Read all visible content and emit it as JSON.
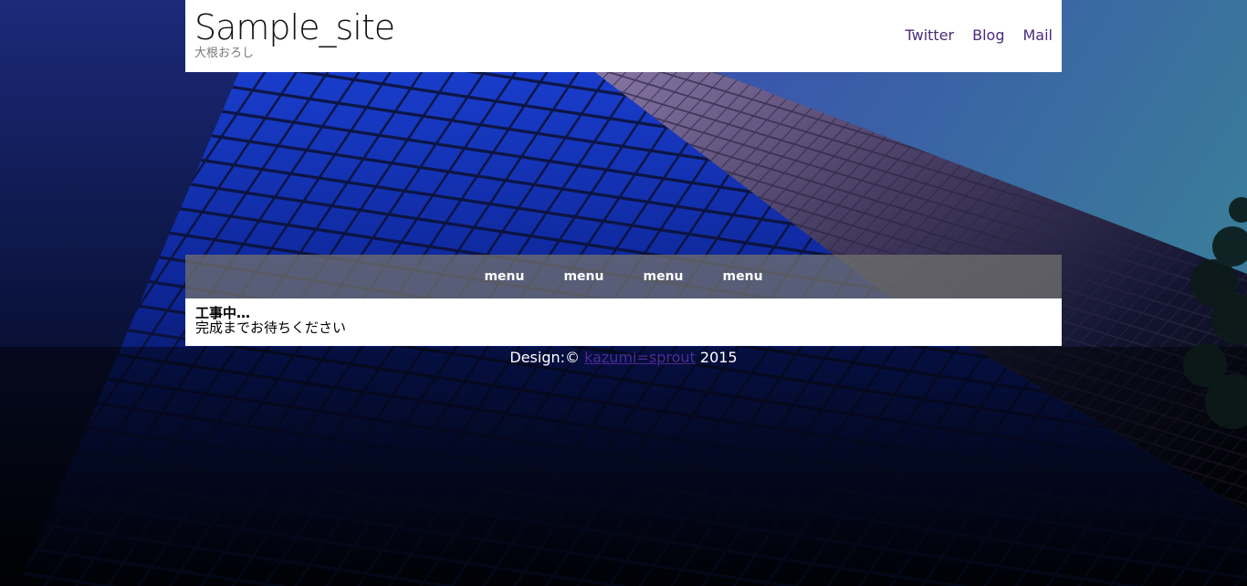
{
  "header": {
    "title": "Sample_site",
    "subtitle": "大根おろし",
    "nav": [
      "Twitter",
      "Blog",
      "Mail"
    ]
  },
  "menu": {
    "items": [
      "menu",
      "menu",
      "menu",
      "menu"
    ]
  },
  "content": {
    "title": "工事中…",
    "text": "完成までお待ちください"
  },
  "footer": {
    "prefix": "Design:©",
    "author_link": "kazumi=sprout",
    "year": "2015"
  },
  "colors": {
    "link": "#4b2a7a",
    "menu_bar": "#6e6e6e",
    "panel": "#ffffff"
  }
}
